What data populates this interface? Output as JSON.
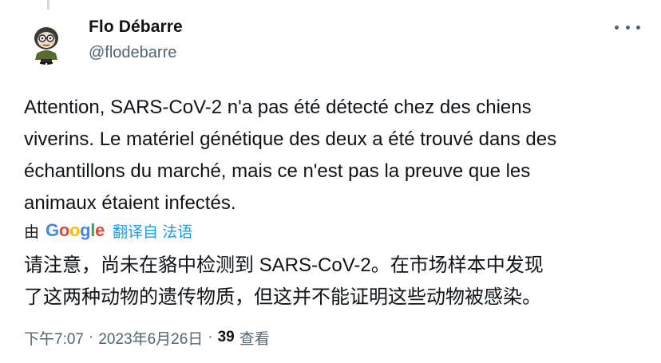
{
  "author": {
    "display_name": "Flo Débarre",
    "handle": "@flodebarre",
    "avatar_icon": "cartoon-avatar-icon"
  },
  "more_icon": "more-horizontal-icon",
  "tweet": {
    "lines": [
      "Attention, SARS-CoV-2 n'a pas été détecté chez des chiens",
      "viverins. Le matériel génétique des deux a été trouvé dans des",
      "échantillons du marché, mais ce n'est pas la preuve que les",
      "animaux étaient infectés."
    ]
  },
  "translation": {
    "by_label": "由",
    "provider_letters": [
      {
        "ch": "G",
        "color": "#4285F4"
      },
      {
        "ch": "o",
        "color": "#EA4335"
      },
      {
        "ch": "o",
        "color": "#FBBC05"
      },
      {
        "ch": "g",
        "color": "#4285F4"
      },
      {
        "ch": "l",
        "color": "#34A853"
      },
      {
        "ch": "e",
        "color": "#EA4335"
      }
    ],
    "translated_from_label": "翻译自 法语",
    "lines": [
      "请注意，尚未在貉中检测到 SARS-CoV-2。在市场样本中发现",
      "了这两种动物的遗传物质，但这并不能证明这些动物被感染。"
    ]
  },
  "meta": {
    "time": "下午7:07",
    "separator": "·",
    "date": "2023年6月26日",
    "views_count": "39",
    "views_label": "查看"
  },
  "colors": {
    "text_primary": "#0f1419",
    "text_secondary": "#536471",
    "link": "#1d9bf0"
  }
}
